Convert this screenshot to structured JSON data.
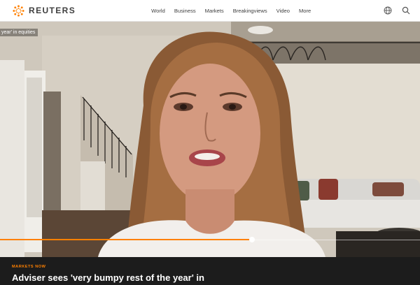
{
  "header": {
    "logo_text": "REUTERS",
    "nav": [
      "World",
      "Business",
      "Markets",
      "Breakingviews",
      "Video",
      "More"
    ],
    "icons": [
      "globe-icon",
      "search-icon"
    ],
    "accent": "#ff8000"
  },
  "video": {
    "caption_chip": "year' in equities",
    "progress_fraction": 0.6
  },
  "article": {
    "kicker": "MARKETS NOW",
    "headline": "Adviser sees 'very bumpy rest of the year' in"
  }
}
